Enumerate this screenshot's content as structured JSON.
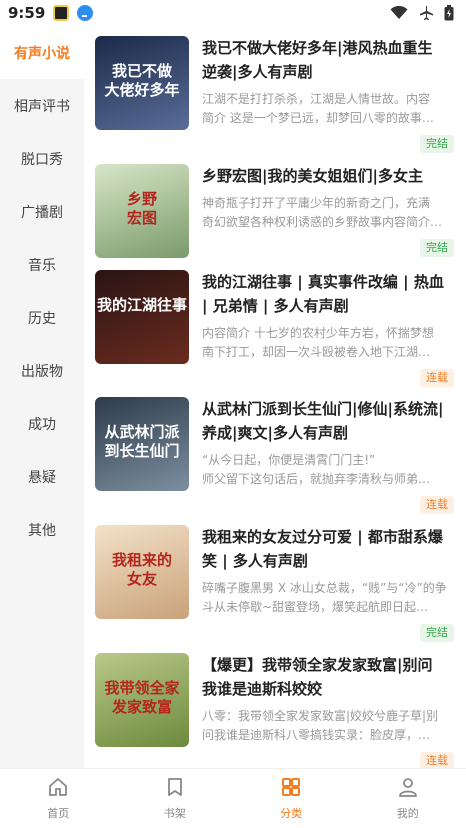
{
  "status_bar": {
    "time": "9:59"
  },
  "sidebar": {
    "active_index": 0,
    "items": [
      {
        "label": "有声小说"
      },
      {
        "label": "相声评书"
      },
      {
        "label": "脱口秀"
      },
      {
        "label": "广播剧"
      },
      {
        "label": "音乐"
      },
      {
        "label": "历史"
      },
      {
        "label": "出版物"
      },
      {
        "label": "成功"
      },
      {
        "label": "悬疑"
      },
      {
        "label": "其他"
      }
    ]
  },
  "books": [
    {
      "title_lines": [
        "我已不做大佬好多年|港风热血重生",
        "逆袭|多人有声剧"
      ],
      "desc_lines": [
        "江湖不是打打杀杀，江湖是人情世故。内容",
        "简介 这是一个梦已远，却梦回八零的故事…"
      ],
      "status": "完结",
      "cover_text": "我已不做\n大佬好多年",
      "cover_colors": [
        "#1b2a48",
        "#5a6d99"
      ]
    },
    {
      "title_lines": [
        "乡野宏图|我的美女姐姐们|多女主"
      ],
      "desc_lines": [
        "神奇瓶子打开了平庸少年的新奇之门，充满",
        "奇幻欲望各种权利诱惑的乡野故事内容简介…"
      ],
      "status": "完结",
      "cover_text": "乡野\n宏图",
      "cover_colors": [
        "#d8e6c8",
        "#7a9a6a"
      ]
    },
    {
      "title_lines": [
        "我的江湖往事 | 真实事件改编 | 热血",
        "| 兄弟情 | 多人有声剧"
      ],
      "desc_lines": [
        "内容简介 十七岁的农村少年方岩，怀揣梦想",
        "南下打工，却因一次斗殴被卷入地下江湖…"
      ],
      "status": "连载",
      "cover_text": "我的江湖往事",
      "cover_colors": [
        "#2a1414",
        "#6b2b1e"
      ]
    },
    {
      "title_lines": [
        "从武林门派到长生仙门|修仙|系统流|",
        "养成|爽文|多人有声剧"
      ],
      "desc_lines": [
        "“从今日起，你便是清霄门门主!”",
        "师父留下这句话后，就抛弃李清秋与师弟…"
      ],
      "status": "连载",
      "cover_text": "从武林门派\n到长生仙门",
      "cover_colors": [
        "#2d3b4a",
        "#7d8fa0"
      ]
    },
    {
      "title_lines": [
        "我租来的女友过分可爱 | 都市甜系爆",
        "笑 | 多人有声剧"
      ],
      "desc_lines": [
        "碎嘴子腹黑男 X 冰山女总裁，“贱”与“冷”的争",
        "斗从未停歇~甜蜜登场，爆笑起航即日起…"
      ],
      "status": "完结",
      "cover_text": "我租来的\n女友",
      "cover_colors": [
        "#f3e2c8",
        "#c9a27a"
      ]
    },
    {
      "title_lines": [
        "【爆更】我带领全家发家致富|别问",
        "我谁是迪斯科姣姣"
      ],
      "desc_lines": [
        "八零：我带领全家发家致富|姣姣兮鹿子草|别",
        "问我谁是迪斯科八零搞钱实录：脸皮厚，…"
      ],
      "status": "连载",
      "cover_text": "我带领全家\n发家致富",
      "cover_colors": [
        "#b9c98a",
        "#6d8a3c"
      ]
    }
  ],
  "bottom_nav": {
    "active_index": 2,
    "items": [
      {
        "label": "首页",
        "icon": "home-icon"
      },
      {
        "label": "书架",
        "icon": "bookshelf-icon"
      },
      {
        "label": "分类",
        "icon": "category-icon"
      },
      {
        "label": "我的",
        "icon": "profile-icon"
      }
    ]
  },
  "colors": {
    "accent": "#f57c1f",
    "done": "#35a84a",
    "serial": "#f07f2a"
  }
}
